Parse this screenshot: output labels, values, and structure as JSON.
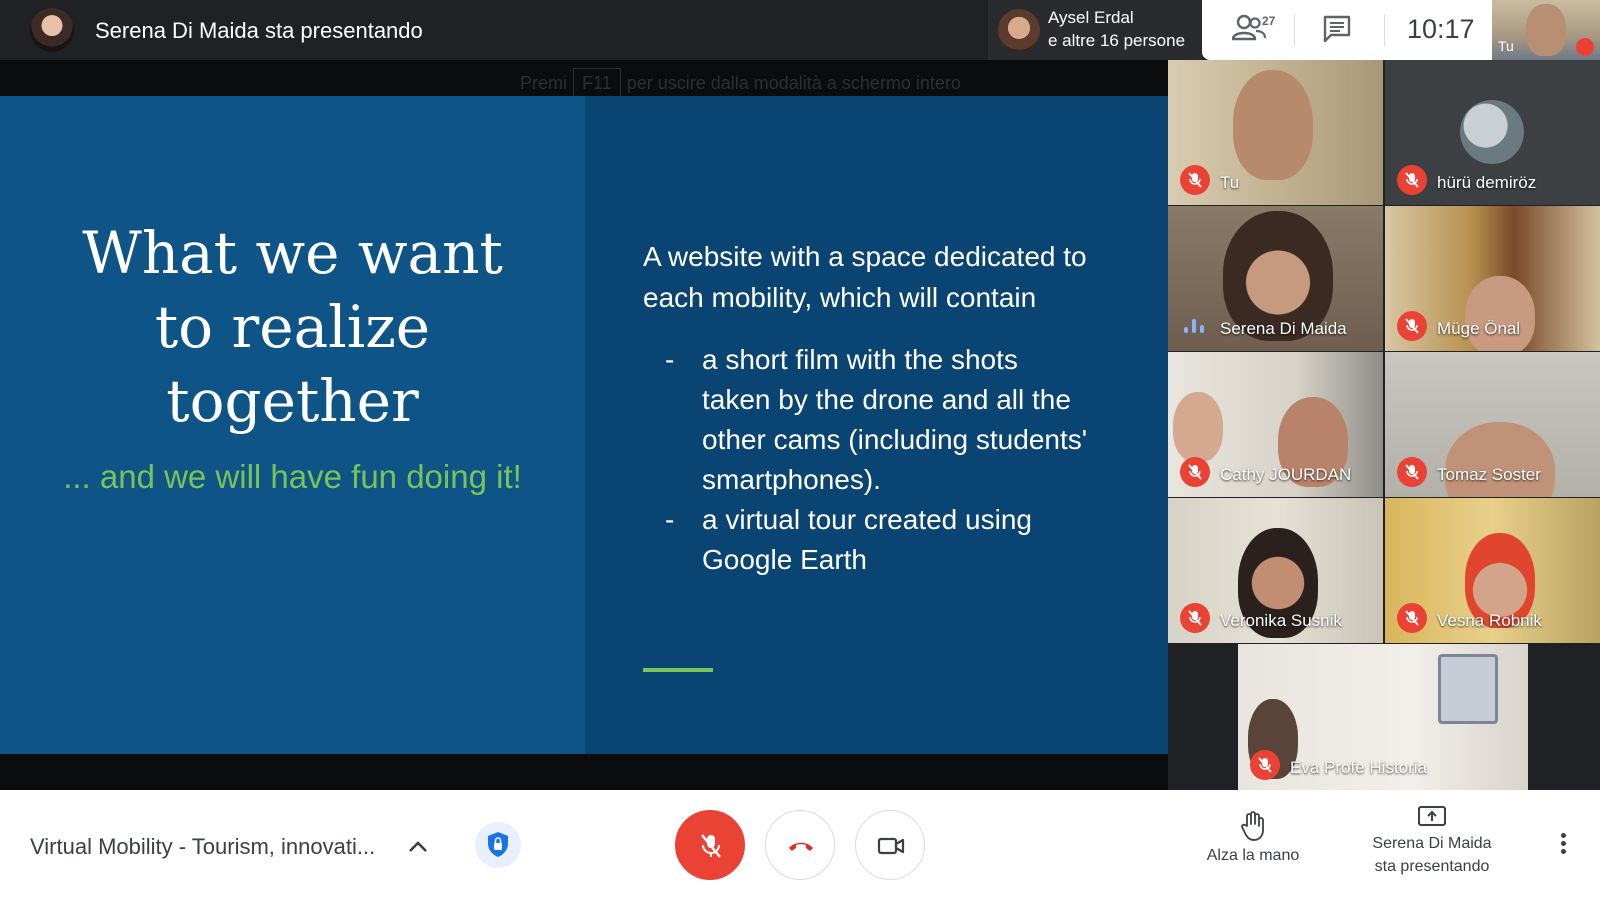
{
  "topbar": {
    "presenter_title": "Serena Di Maida sta presentando",
    "others_name": "Aysel Erdal",
    "others_sub": "e altre 16 persone",
    "people_count": "27",
    "clock": "10:17",
    "self_label": "Tu"
  },
  "stage": {
    "fullscreen_hint_prefix": "Premi",
    "fullscreen_hint_key": "F11",
    "fullscreen_hint_suffix": "per uscire dalla modalità a schermo intero"
  },
  "slide": {
    "title_lines": [
      "What we want",
      "to realize",
      "together"
    ],
    "subtitle": "... and we will have fun doing it!",
    "intro_lines": [
      "A website with a space dedicated to",
      "each mobility, which will contain"
    ],
    "bullets": [
      [
        "a short film with the shots",
        "taken by the drone and all the",
        "other cams (including students'",
        "smartphones)."
      ],
      [
        "a virtual tour created using",
        "Google Earth"
      ]
    ]
  },
  "participants": [
    {
      "name": "Tu"
    },
    {
      "name": "hürü demiröz"
    },
    {
      "name": "Serena Di Maida"
    },
    {
      "name": "Müge Önal"
    },
    {
      "name": "Cathy JOURDAN"
    },
    {
      "name": "Tomaz Soster"
    },
    {
      "name": "Veronika Susnik"
    },
    {
      "name": "Vesna Robnik"
    },
    {
      "name": "Eva Profe Historia"
    }
  ],
  "bottombar": {
    "meeting_title": "Virtual Mobility - Tourism, innovati...",
    "raise_hand": "Alza la mano",
    "presenting_line1": "Serena Di Maida",
    "presenting_line2": "sta presentando"
  },
  "colors": {
    "slide_bg": "#0a4472",
    "slide_left_bg": "#0f5486",
    "accent_green": "#78c35a",
    "mic_off_red": "#ea4335",
    "speaking_blue": "#8ab4f8"
  },
  "icons": [
    "people-icon",
    "chat-icon",
    "mic-off-icon",
    "hang-up-icon",
    "camera-icon",
    "shield-icon",
    "hand-icon",
    "present-icon",
    "chevron-up-icon",
    "more-vert-icon"
  ]
}
